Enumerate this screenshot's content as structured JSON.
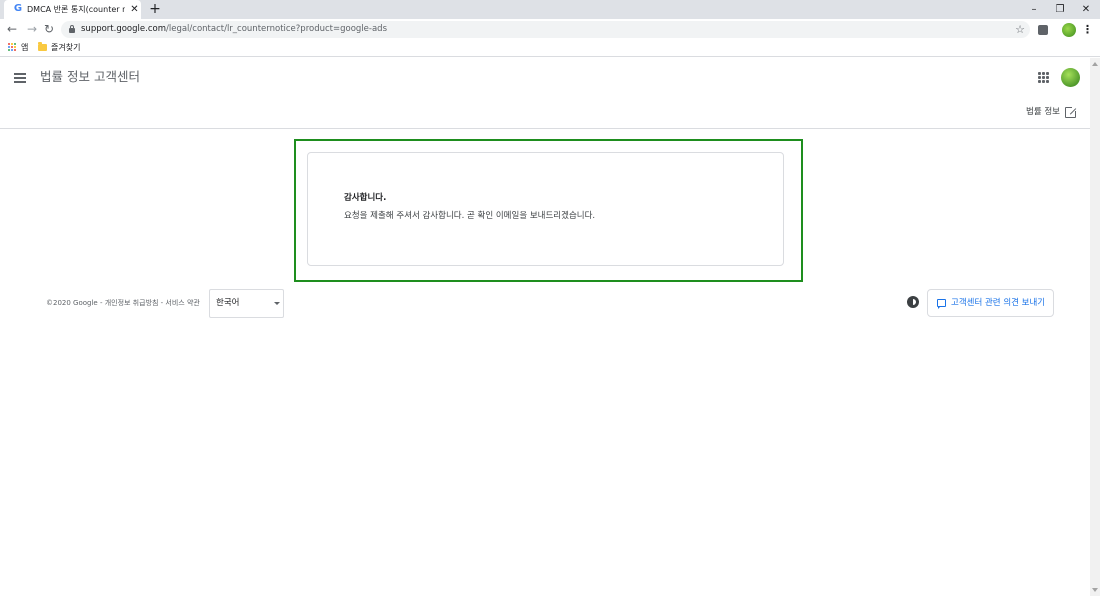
{
  "browser": {
    "tab": {
      "favicon": "G",
      "title": "DMCA 반론 통지(counter notific",
      "close_glyph": "✕"
    },
    "new_tab_glyph": "+",
    "window": {
      "minimize": "–",
      "maximize": "❐",
      "close": "✕"
    },
    "nav": {
      "back": "←",
      "forward": "→",
      "reload": "↻"
    },
    "url": {
      "host": "support.google.com",
      "path": "/legal/contact/lr_counternotice?product=google-ads"
    },
    "star_glyph": "☆",
    "menu_glyph": "⋮",
    "bookmarks": {
      "apps_label": "앱",
      "favorites_label": "즐겨찾기"
    },
    "apps_colors": [
      "#ea4335",
      "#fbbc05",
      "#34a853",
      "#4285f4",
      "#ea4335",
      "#fbbc05",
      "#34a853",
      "#4285f4",
      "#ea4335"
    ]
  },
  "header": {
    "title": "법률 정보 고객센터",
    "legal_link": "법률 정보"
  },
  "card": {
    "title": "감사합니다.",
    "message": "요청을 제출해 주셔서 감사합니다. 곧 확인 이메일을 보내드리겠습니다."
  },
  "footer": {
    "copyright": "©2020 Google - 개인정보 취급방침 - 서비스 약관",
    "language": "한국어",
    "feedback_button": "고객센터 관련 의견 보내기"
  },
  "colors": {
    "highlight_border": "#1e8e1e",
    "link_blue": "#1a73e8"
  }
}
